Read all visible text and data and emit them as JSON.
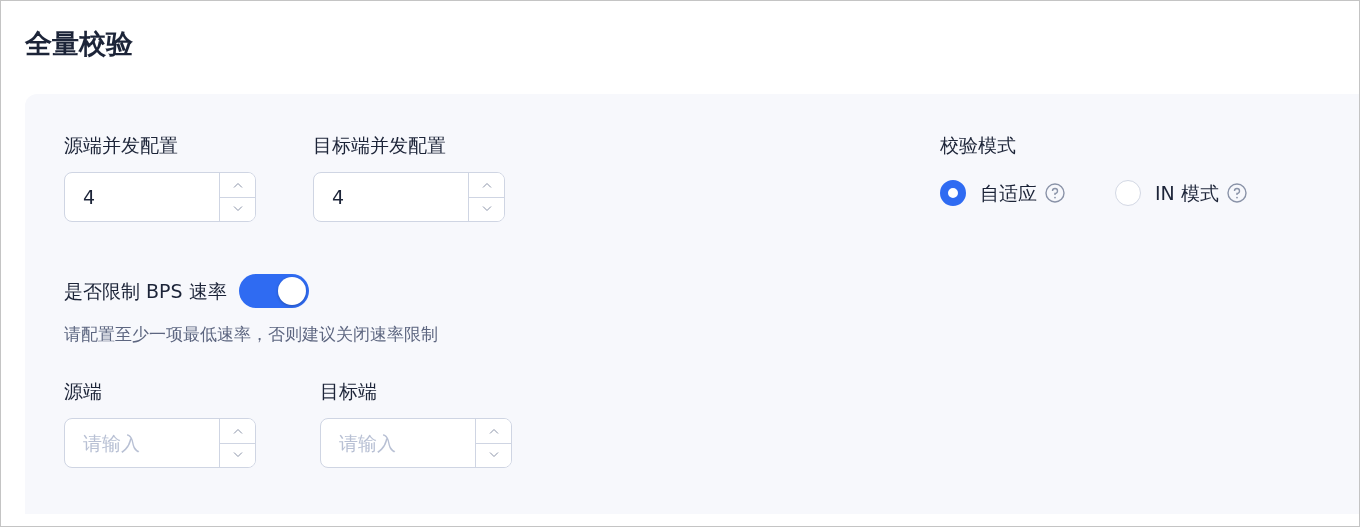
{
  "page": {
    "title": "全量校验"
  },
  "concurrency": [
    {
      "label": "源端并发配置",
      "value": "4"
    },
    {
      "label": "目标端并发配置",
      "value": "4"
    }
  ],
  "verify_mode": {
    "label": "校验模式",
    "options": [
      {
        "label": "自适应",
        "selected": true,
        "help": true
      },
      {
        "label": "IN 模式",
        "selected": false,
        "help": true
      }
    ]
  },
  "bps_limit": {
    "label": "是否限制 BPS 速率",
    "on": true,
    "hint": "请配置至少一项最低速率，否则建议关闭速率限制"
  },
  "rates": [
    {
      "label": "源端",
      "placeholder": "请输入"
    },
    {
      "label": "目标端",
      "placeholder": "请输入"
    }
  ]
}
